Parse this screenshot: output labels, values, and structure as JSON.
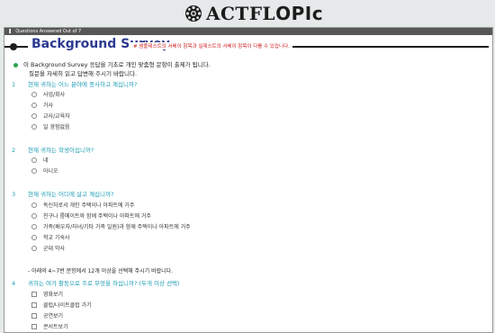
{
  "header": {
    "logo_text_a": "ACTFL",
    "logo_text_b": "OPIc"
  },
  "progress": {
    "label": "Questions Answered Out of  7"
  },
  "title": {
    "text": "Background Survey",
    "note": "# 샘플테스트의 서베이 항목과 실제스트의 서베이 항목이 다를 수 있습니다."
  },
  "intro": {
    "line1": "이 Background Survey 응답을 기초로 개인 맞춤형 문항이 출제가 됩니다.",
    "line2": "질문을 자세히 읽고 답변해 주시기 바랍니다."
  },
  "questions": [
    {
      "num": "1",
      "text": "현재 귀하는 어느 분야에 종사하고 계십니까?",
      "options": [
        "사업/회사",
        "가사",
        "교사/교육자",
        "일 경험없음"
      ]
    },
    {
      "num": "2",
      "text": "현재 귀하는 학생이십니까?",
      "options": [
        "네",
        "아니오"
      ]
    },
    {
      "num": "3",
      "text": "현재 귀하는 어디에 살고 계십니까?",
      "options": [
        "독신자로서 개인 주택이나 아파트에 거주",
        "친구나 룸메이트와 함께 주택이나 아파트에 거주",
        "가족(배우자/자녀/기타 가족 일원)과 함께 주택이나 아파트에 거주",
        "학교 기숙사",
        "군대 막사"
      ]
    },
    {
      "num": "4",
      "text": "귀하는 여가 활동으로 주로 무엇을 하십니까? (두개 이상 선택)",
      "options": [
        "영화보기",
        "클럽/나이트클럽 가기",
        "공연보기",
        "콘서트보기"
      ]
    }
  ],
  "note": "- 아래의 4~7번 문항에서 12개 이상을 선택해 주시기 바랍니다."
}
